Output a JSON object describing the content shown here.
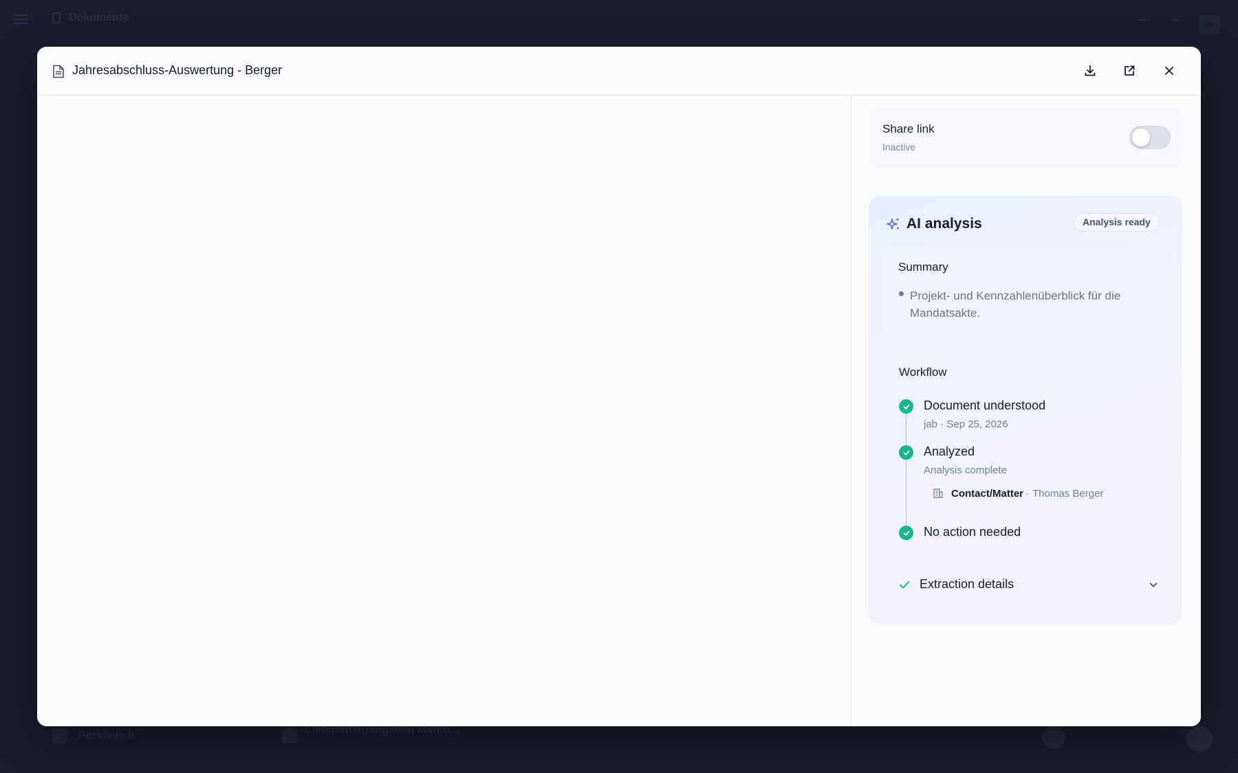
{
  "background": {
    "app_title": "Dokumente",
    "bottom_label": "Persönlich",
    "bottom_file": "Lieferantenrangaben Marktr..."
  },
  "modal": {
    "title": "Jahresabschluss-Auswertung - Berger",
    "actions": {
      "download_icon": "download-icon",
      "open_external_icon": "external-link-icon",
      "close_icon": "close-icon"
    }
  },
  "share_link": {
    "title": "Share link",
    "status": "Inactive",
    "enabled": false
  },
  "ai_analysis": {
    "title": "AI analysis",
    "badge": "Analysis ready",
    "summary": {
      "title": "Summary",
      "bullets": [
        "Projekt- und Kennzahlenüberblick für die Mandatsakte."
      ]
    },
    "workflow": {
      "title": "Workflow",
      "steps": [
        {
          "title": "Document understood",
          "subtitle": "jab · Sep 25, 2026"
        },
        {
          "title": "Analyzed",
          "subtitle": "Analysis complete"
        },
        {
          "title": "No action needed",
          "subtitle": ""
        }
      ],
      "contact": {
        "label": "Contact/Matter",
        "separator": "·",
        "value": "Thomas Berger"
      }
    },
    "extraction": {
      "label": "Extraction details"
    }
  },
  "colors": {
    "backdrop": "#1b1d2e",
    "success": "#12b886",
    "accent": "#5b6fd6"
  }
}
